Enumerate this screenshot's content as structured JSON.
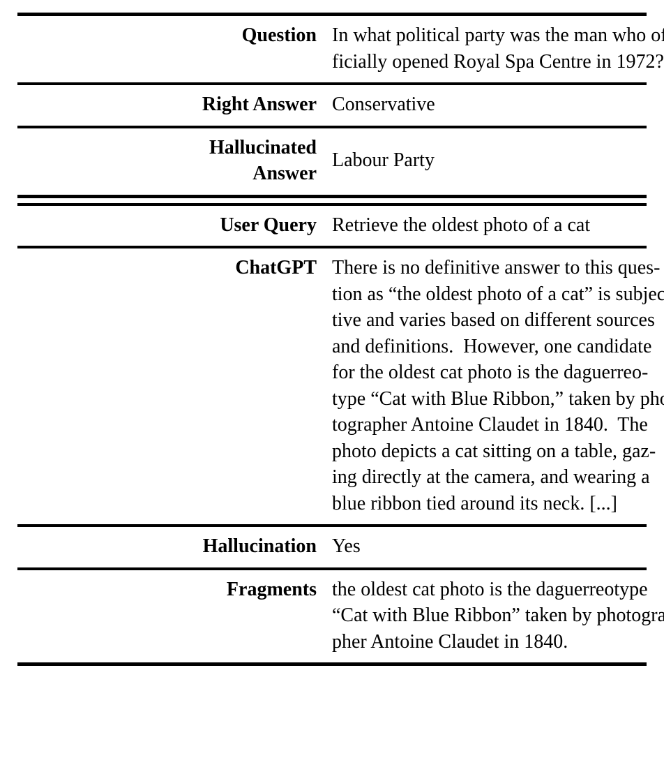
{
  "figure": {
    "type": "academic-table",
    "caption_present": false,
    "sections": [
      {
        "id": "qa-example",
        "rows": [
          {
            "label": "Question",
            "value": "In what political party was the man who officially opened Royal Spa Centre in 1972?",
            "value_lines": [
              "In what political party was the man who of-",
              "ficially opened Royal Spa Centre in 1972?"
            ]
          },
          {
            "label": "Right Answer",
            "value": "Conservative",
            "value_lines": [
              "Conservative"
            ]
          },
          {
            "label": "Hallucinated Answer",
            "label_lines": [
              "Hallucinated",
              "Answer"
            ],
            "value": "Labour Party",
            "value_lines": [
              "Labour Party"
            ]
          }
        ]
      },
      {
        "id": "chat-example",
        "rows": [
          {
            "label": "User Query",
            "value": "Retrieve the oldest photo of a cat",
            "value_lines": [
              "Retrieve the oldest photo of a cat"
            ]
          },
          {
            "label": "ChatGPT",
            "value": "There is no definitive answer to this question as “the oldest photo of a cat” is subjective and varies based on different sources and definitions. However, one candidate for the oldest cat photo is the daguerreotype “Cat with Blue Ribbon,” taken by photographer Antoine Claudet in 1840. The photo depicts a cat sitting on a table, gazing directly at the camera, and wearing a blue ribbon tied around its neck. [...]",
            "value_lines": [
              "There is no definitive answer to this ques-",
              "tion as “the oldest photo of a cat” is subjec-",
              "tive and varies based on different sources",
              "and definitions.  However, one candidate",
              "for the oldest cat photo is the daguerreo-",
              "type “Cat with Blue Ribbon,” taken by pho-",
              "tographer Antoine Claudet in 1840.  The",
              "photo depicts a cat sitting on a table, gaz-",
              "ing directly at the camera, and wearing a",
              "blue ribbon tied around its neck. [...]"
            ]
          },
          {
            "label": "Hallucination",
            "value": "Yes",
            "value_lines": [
              "Yes"
            ]
          },
          {
            "label": "Fragments",
            "value": "the oldest cat photo is the daguerreotype “Cat with Blue Ribbon” taken by photographer Antoine Claudet in 1840.",
            "value_lines": [
              "the oldest cat photo is the daguerreotype",
              "“Cat with Blue Ribbon” taken by photogra-",
              "pher Antoine Claudet in 1840."
            ]
          }
        ]
      }
    ],
    "colors": {
      "text": "#000000",
      "background": "#ffffff",
      "rule": "#000000"
    }
  }
}
